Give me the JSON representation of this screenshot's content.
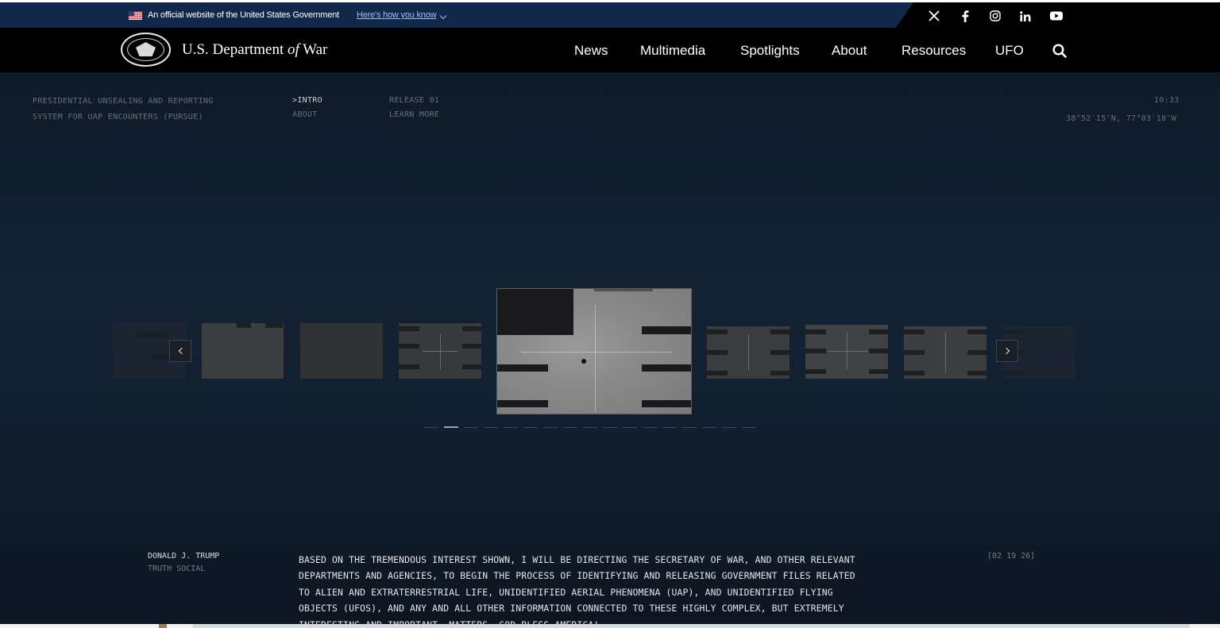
{
  "gov_banner": {
    "text": "An official website of the United States Government",
    "link": "Here's how you know"
  },
  "social": [
    "x-icon",
    "facebook-icon",
    "instagram-icon",
    "linkedin-icon",
    "youtube-icon"
  ],
  "brand": {
    "prefix": "U.S. Department ",
    "of": "of",
    "suffix": " War"
  },
  "nav": {
    "items": [
      "News",
      "Multimedia",
      "Spotlights",
      "About",
      "Resources",
      "UFO"
    ]
  },
  "hero": {
    "title_line1": "PRESIDENTIAL UNSEALING AND REPORTING",
    "title_line2": "SYSTEM FOR UAP ENCOUNTERS (PURSUE)",
    "menu_intro": ">INTRO",
    "menu_about": "ABOUT",
    "release": "RELEASE 01",
    "learn_more": "LEARN MORE",
    "time": "10:33",
    "coords": "38°52′15″N, 77°03′18″W"
  },
  "carousel": {
    "slide_count": 17,
    "active_index": 1
  },
  "quote": {
    "author": "DONALD J. TRUMP",
    "source": "TRUTH SOCIAL",
    "date": "[02 19 26]",
    "text": "BASED ON THE TREMENDOUS INTEREST SHOWN, I WILL BE DIRECTING THE SECRETARY OF WAR, AND OTHER RELEVANT DEPARTMENTS AND AGENCIES, TO BEGIN THE PROCESS OF IDENTIFYING AND RELEASING GOVERNMENT FILES RELATED TO ALIEN AND EXTRATERRESTRIAL LIFE, UNIDENTIFIED AERIAL PHENOMENA (UAP), AND UNIDENTIFIED FLYING OBJECTS (UFOS), AND ANY AND ALL OTHER INFORMATION CONNECTED TO THESE HIGHLY COMPLEX, BUT EXTREMELY INTERESTING AND IMPORTANT, MATTERS. GOD BLESS AMERICA!"
  },
  "colors": {
    "banner": "#12284a",
    "nav": "#000000",
    "hero": "#142232",
    "accent_link": "#9fc2ea"
  }
}
